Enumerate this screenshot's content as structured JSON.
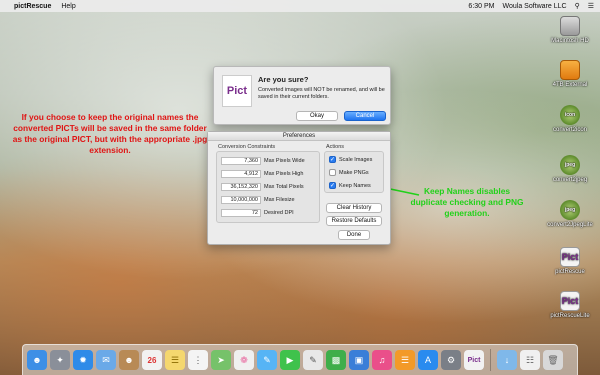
{
  "menubar": {
    "apple": "",
    "app_name": "pictRescue",
    "menus": [
      "Help"
    ],
    "time": "6:30 PM",
    "user": "Woula Software LLC"
  },
  "desktop_icons": [
    {
      "label": "Macintosh HD",
      "icon": "hard-drive-icon"
    },
    {
      "label": "4TB External",
      "icon": "external-drive-icon"
    },
    {
      "label": "convert2icon",
      "icon": "convert2icon-app-icon",
      "badge": "icon"
    },
    {
      "label": "convert2jpeg",
      "icon": "convert2jpeg-app-icon",
      "badge": "jpeg"
    },
    {
      "label": "convert2JpegLite",
      "icon": "convert2jpeglite-app-icon",
      "badge": "jpeg"
    },
    {
      "label": "pictRescue",
      "icon": "pictrescue-app-icon",
      "badge": "Pict"
    },
    {
      "label": "pictRescueLite",
      "icon": "pictrescuelite-app-icon",
      "badge": "Pict"
    }
  ],
  "notes": {
    "left": "If you choose to keep the original names the converted PICTs will be saved in the same folder as the original PICT, but with the appropriate .jpg extension.",
    "right": "Keep Names disables duplicate checking and PNG generation."
  },
  "alert": {
    "icon_text": "Pict",
    "title": "Are you sure?",
    "message": "Converted images will NOT be renamed, and will be saved in their current folders.",
    "ok_label": "Okay",
    "cancel_label": "Cancel"
  },
  "prefs": {
    "title": "Preferences",
    "constraints_title": "Conversion Constraints",
    "constraints": [
      {
        "value": "7,360",
        "label": "Max Pixels Wide"
      },
      {
        "value": "4,912",
        "label": "Max Pixels High"
      },
      {
        "value": "36,152,320",
        "label": "Max Total Pixels"
      },
      {
        "value": "10,000,000",
        "label": "Max Filesize"
      },
      {
        "value": "72",
        "label": "Desired DPI"
      }
    ],
    "actions_title": "Actions",
    "options": [
      {
        "label": "Scale Images",
        "checked": true
      },
      {
        "label": "Make PNGs",
        "checked": false
      },
      {
        "label": "Keep Names",
        "checked": true
      }
    ],
    "clear_history_label": "Clear History",
    "restore_defaults_label": "Restore Defaults",
    "done_label": "Done"
  },
  "dock": {
    "icons": [
      {
        "name": "finder-icon",
        "color": "#3d8fe6"
      },
      {
        "name": "launchpad-icon",
        "color": "#8a8f99"
      },
      {
        "name": "safari-icon",
        "color": "#2f8be8"
      },
      {
        "name": "mail-icon",
        "color": "#6aa9e8"
      },
      {
        "name": "contacts-icon",
        "color": "#b88a55"
      },
      {
        "name": "calendar-icon",
        "color": "#f2f2f2"
      },
      {
        "name": "notes-icon",
        "color": "#f5d76e"
      },
      {
        "name": "reminders-icon",
        "color": "#f4f4f4"
      },
      {
        "name": "maps-icon",
        "color": "#76c26a"
      },
      {
        "name": "photos-icon",
        "color": "#f0f0f0"
      },
      {
        "name": "messages-icon",
        "color": "#56b4f5"
      },
      {
        "name": "facetime-icon",
        "color": "#3fc24c"
      },
      {
        "name": "notepad-icon",
        "color": "#e8e8e8"
      },
      {
        "name": "numbers-icon",
        "color": "#3fae4a"
      },
      {
        "name": "keynote-icon",
        "color": "#3a7ed8"
      },
      {
        "name": "itunes-icon",
        "color": "#ea4f8a"
      },
      {
        "name": "ibooks-icon",
        "color": "#f39a28"
      },
      {
        "name": "app-store-icon",
        "color": "#2a8bef"
      },
      {
        "name": "system-preferences-icon",
        "color": "#7a7f87"
      },
      {
        "name": "pictrescue-dock-icon",
        "color": "#f2f2f2"
      }
    ],
    "right_icons": [
      {
        "name": "downloads-folder-icon",
        "color": "#7fb8ea"
      },
      {
        "name": "document-stack-icon",
        "color": "#f0f0f0"
      },
      {
        "name": "trash-icon",
        "color": "#d8d8d8"
      }
    ],
    "calendar_day": "26"
  }
}
